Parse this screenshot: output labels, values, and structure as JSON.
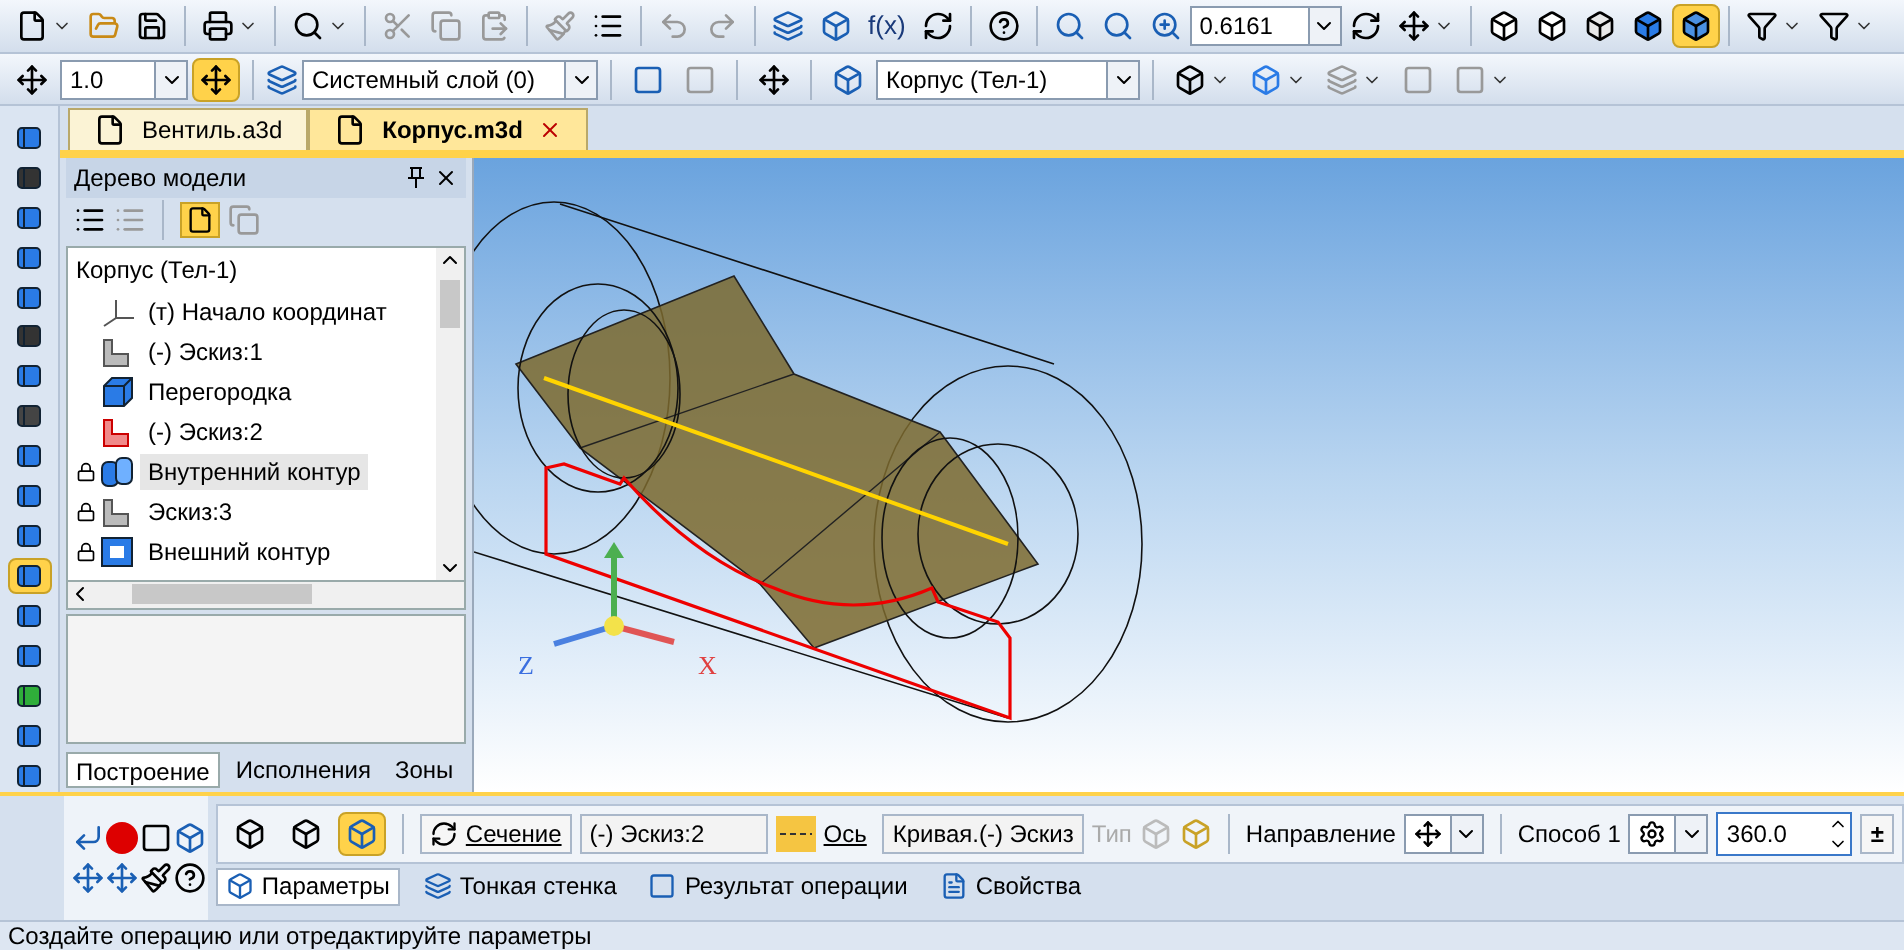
{
  "toolbar_top": {
    "formula_label": "f(x)",
    "zoom": {
      "value": "0.6161"
    },
    "view_modes": [
      {
        "kind": "wire",
        "selected": false
      },
      {
        "kind": "hidden",
        "selected": false
      },
      {
        "kind": "thin",
        "selected": false
      },
      {
        "kind": "shaded",
        "selected": false
      },
      {
        "kind": "shaded-edges",
        "selected": true
      }
    ]
  },
  "toolbar_second": {
    "step": {
      "value": "1.0"
    },
    "snap": {
      "on": true
    },
    "layer": {
      "value": "Системный слой (0)"
    },
    "body": {
      "value": "Корпус (Тел-1)"
    }
  },
  "left_toolbar": {
    "items": [
      {
        "kind": "extrude",
        "selected": false
      },
      {
        "kind": "spline",
        "selected": false
      },
      {
        "kind": "sweep",
        "selected": false
      },
      {
        "kind": "array",
        "selected": false
      },
      {
        "kind": "point",
        "selected": false
      },
      {
        "kind": "angle",
        "selected": false
      },
      {
        "kind": "funnel",
        "selected": false
      },
      {
        "kind": "sheet",
        "selected": false
      },
      {
        "kind": "frame",
        "selected": false
      },
      {
        "kind": "measure",
        "selected": false
      },
      {
        "kind": "bend",
        "selected": false
      },
      {
        "kind": "rotate",
        "selected": true
      },
      {
        "kind": "shell",
        "selected": false
      },
      {
        "kind": "cut",
        "selected": false
      },
      {
        "kind": "combine",
        "selected": false
      },
      {
        "kind": "surface",
        "selected": false
      },
      {
        "kind": "round",
        "selected": false
      }
    ]
  },
  "doc_tabs": [
    {
      "label": "Вентиль.a3d",
      "selected": false
    },
    {
      "label": "Корпус.m3d",
      "selected": true
    }
  ],
  "tree_panel": {
    "title": "Дерево модели",
    "root": "Корпус (Тел-1)",
    "items": [
      {
        "kind": "origin",
        "label": "(т) Начало координат",
        "locked": false,
        "selected": false
      },
      {
        "kind": "sketch",
        "label": "(-)  Эскиз:1",
        "locked": false,
        "selected": false
      },
      {
        "kind": "extrude",
        "label": "Перегородка",
        "locked": false,
        "selected": false
      },
      {
        "kind": "sketch-red",
        "label": "(-)  Эскиз:2",
        "locked": false,
        "selected": false
      },
      {
        "kind": "rotate",
        "label": "Внутренний контур",
        "locked": true,
        "selected": true
      },
      {
        "kind": "sketch",
        "label": " Эскиз:3",
        "locked": true,
        "selected": false
      },
      {
        "kind": "rotate-outer",
        "label": "Внешний контур",
        "locked": true,
        "selected": false
      }
    ],
    "tabs": [
      {
        "label": "Построение",
        "selected": true
      },
      {
        "label": "Исполнения",
        "selected": false
      },
      {
        "label": "Зоны",
        "selected": false
      }
    ]
  },
  "viewport": {
    "axis_labels": [
      {
        "kind": "z",
        "label": "Z"
      },
      {
        "kind": "x",
        "label": "X"
      }
    ]
  },
  "property_bar": {
    "section_label": "Сечение",
    "section_value": "(-) Эскиз:2",
    "axis_label": "Ось",
    "axis_value": "Кривая.(-) Эскиз",
    "type_label": "Тип",
    "type_disabled": true,
    "direction_label": "Направление",
    "method_label": "Способ 1",
    "angle": {
      "value": "360.0"
    },
    "sign_label": "±",
    "tabs": [
      {
        "kind": "params",
        "label": "Параметры",
        "selected": true
      },
      {
        "kind": "thin",
        "label": "Тонкая стенка",
        "selected": false
      },
      {
        "kind": "result",
        "label": "Результат операции",
        "selected": false
      },
      {
        "kind": "props",
        "label": "Свойства",
        "selected": false
      }
    ]
  },
  "status_bar": "Создайте операцию или отредактируйте параметры"
}
